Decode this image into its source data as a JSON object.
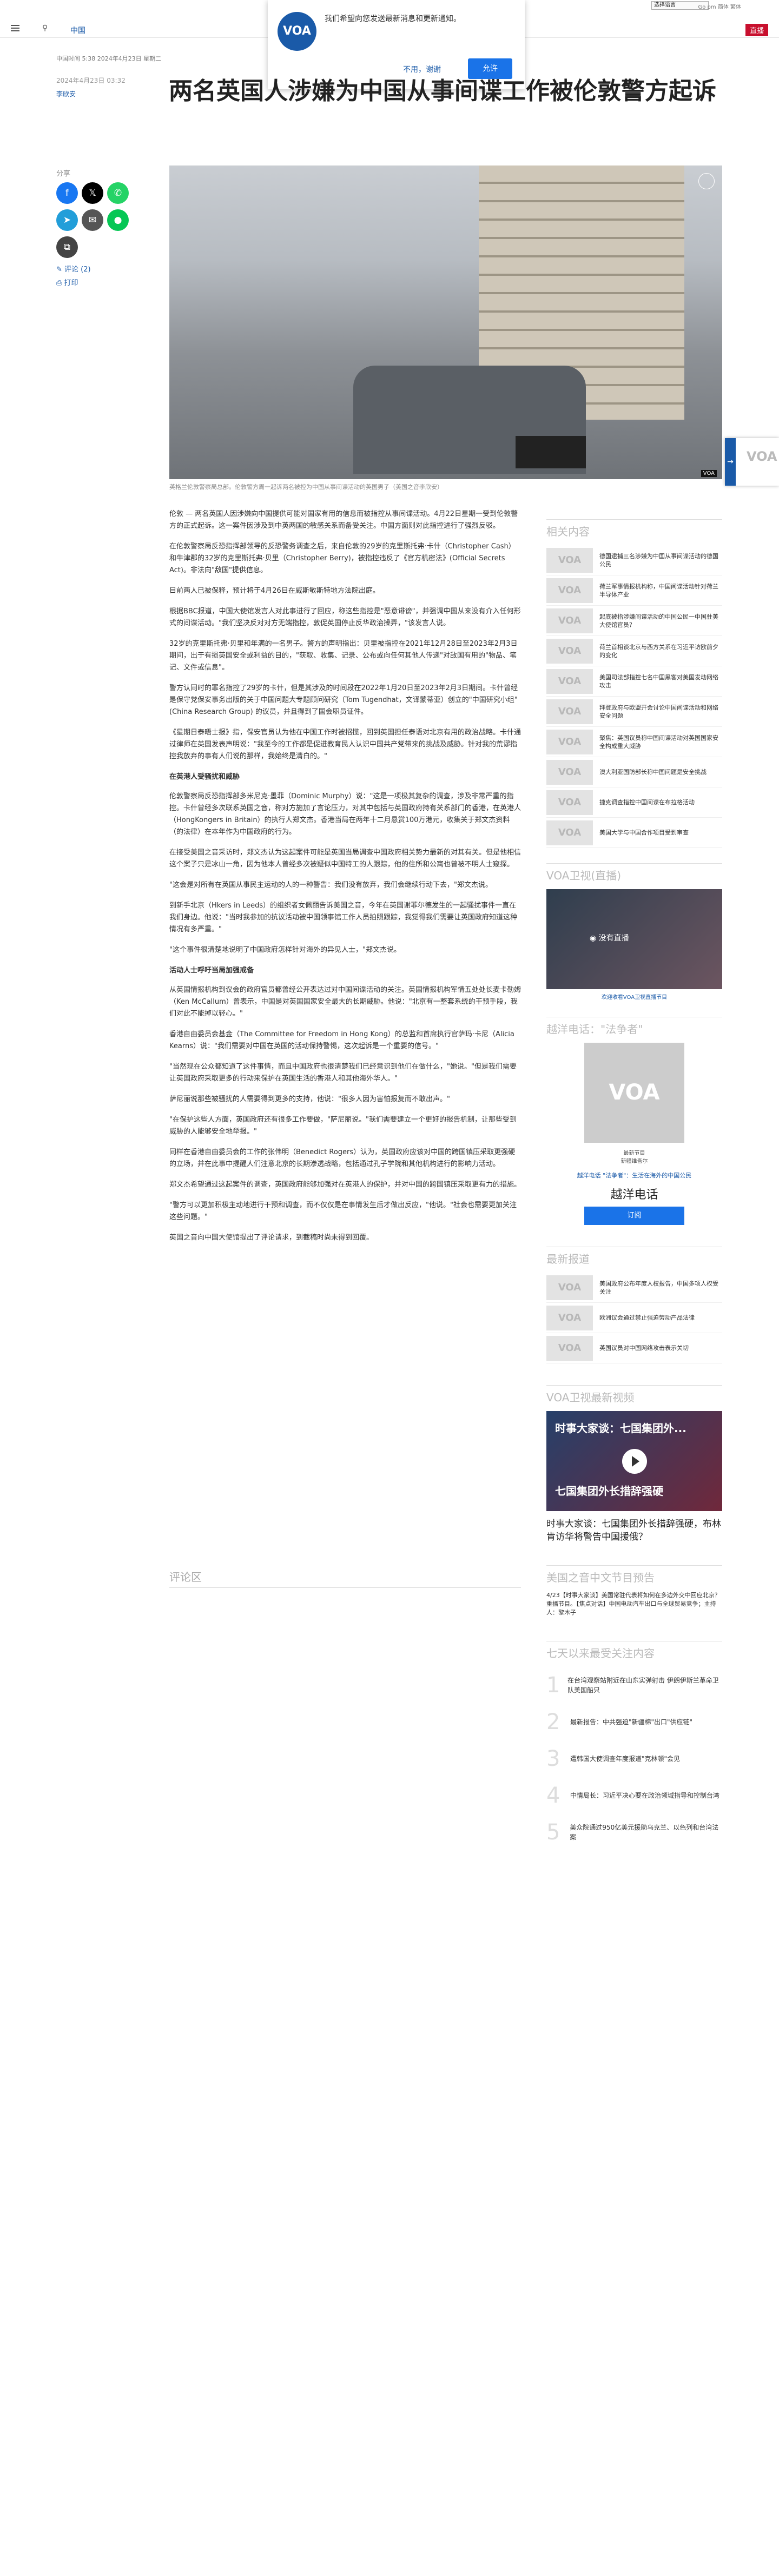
{
  "topbar": {
    "section": "中国",
    "lang_select": "选择语言",
    "lang_links": "Go pm 简体 繁体",
    "live": "直播"
  },
  "popup": {
    "logo": "VOA",
    "message": "我们希望向您发送最新消息和更新通知。",
    "decline": "不用，谢谢",
    "accept": "允许"
  },
  "article": {
    "meta": "中国时间 5:38 2024年4月23日 星期二",
    "pubdate": "2024年4月23日 03:32",
    "author": "李欣安",
    "title": "两名英国人涉嫌为中国从事间谍工作被伦敦警方起诉",
    "caption": "英格兰伦敦警察局总部。伦敦警方周一起诉两名被控为中国从事间谍活动的英国男子（美国之音李欣安）",
    "paragraphs": [
      "伦敦 — 两名英国人因涉嫌向中国提供可能对国家有用的信息而被指控从事间谍活动。4月22日星期一受到伦敦警方的正式起诉。这一案件因涉及到中英两国的敏感关系而备受关注。中国方面则对此指控进行了强烈反驳。",
      "在伦敦警察局反恐指挥部领导的反恐警务调查之后，来自伦敦的29岁的克里斯托弗·卡什（Christopher Cash）和牛津郡的32岁的克里斯托弗·贝里（Christopher Berry)，被指控违反了《官方机密法》(Official Secrets Act)。非法向\"敌国\"提供信息。",
      "目前两人已被保释，预计将于4月26日在威斯敏斯特地方法院出庭。",
      "根据BBC报道，中国大使馆发言人对此事进行了回应，称这些指控是\"恶意诽谤\"，并强调中国从来没有介入任何形式的间谍活动。\"我们坚决反对对方无端指控，敦促英国停止反华政治操弄，\"该发言人说。",
      "32岁的克里斯托弗·贝里和年满的一名男子。警方的声明指出：贝里被指控在2021年12月28日至2023年2月3日期间，出于有损英国安全或利益的目的，\"获取、收集、记录、公布或向任何其他人传递\"对敌国有用的\"物品、笔记、文件或信息\"。",
      "警方认同时的罪名指控了29岁的卡什，但是其涉及的时间段在2022年1月20日至2023年2月3日期间。卡什曾经是保守党保安事务出版的关于中国问题大专题顾问研究（Tom Tugendhat，文译蒙蒂亚）创立的\"中国研究小组\"(China Research Group) 的议员，并且得到了国会职员证件。",
      "《星期日泰晤士报》指，保安官员认为他在中国工作时被招揽，回到英国担任泰语对北京有用的政治战略。卡什通过律师在英国发表声明说：\"我至今的工作都是促进教育民人认识中国共产党带来的挑战及威胁。针对我的荒谬指控我放弃的事有人们说的那样，我始终是清白的。\""
    ],
    "h_uk": "在英港人受骚扰和威胁",
    "paragraphs2": [
      "伦敦警察局反恐指挥部多米尼克·墨菲（Dominic Murphy）说：\"这是一项极其复杂的调查，涉及非常严重的指控。卡什曾经多次联系英国之音，称对方施加了言论压力，对其中包括与英国政府持有关系部门的香港，在英港人（HongKongers in Britain）的执行人郑文杰。香港当局在两年十二月悬赏100万港元，收集关于郑文杰资料（的法律）在本年作为中国政府的行为。",
      "在接受美国之音采访时，郑文杰认为这起案件可能是英国当局调查中国政府相关势力最新的对其有关。但是他相信这个案子只是冰山一角，因为他本人曾经多次被疑似中国特工的人跟踪，他的住所和公寓也曾被不明人士窥探。",
      "\"这会是对所有在英国从事民主运动的人的一种警告：我们没有放弃，我们会继续行动下去，\"郑文杰说。",
      "到新手北京（Hkers in Leeds）的组织者女佩丽告诉美国之音，今年在英国谢菲尔德发生的一起骚扰事件一直在我们身边。他说：\"当时我参加的抗议活动被中国领事馆工作人员拍照跟踪，我觉得我们需要让英国政府知道这种情况有多严重。\"",
      "\"这个事件很清楚地说明了中国政府怎样针对海外的异见人士，\"郑文杰说。"
    ],
    "h_act": "活动人士呼吁当局加强戒备",
    "paragraphs3": [
      "从英国情报机构到议会的政府官员都曾经公开表达过对中国间谍活动的关注。英国情报机构军情五处处长麦卡勒姆（Ken McCallum）曾表示，中国是对英国国家安全最大的长期威胁。他说：\"北京有一整套系统的干预手段，我们对此不能掉以轻心。\"",
      "香港自由委员会基金（The Committee for Freedom in Hong Kong）的总监和首席执行官萨玛·卡尼（Alicia Kearns）说：\"我们需要对中国在英国的活动保持警惕，这次起诉是一个重要的信号。\"",
      "\"当然现在公众都知道了这件事情，而且中国政府也很清楚我们已经意识到他们在做什么，\"她说。\"但是我们需要让英国政府采取更多的行动来保护在英国生活的香港人和其他海外华人。\"",
      "萨尼丽说那些被骚扰的人需要得到更多的支持，他说：\"很多人因为害怕报复而不敢出声。\"",
      "\"在保护这些人方面，英国政府还有很多工作要做，\"萨尼丽说。\"我们需要建立一个更好的报告机制，让那些受到威胁的人能够安全地举报。\"",
      "同样在香港自由委员会的工作的张伟明（Benedict Rogers）认为，英国政府应该对中国的跨国镇压采取更强硬的立场，并在此事中提醒人们注意北京的长期渗透战略，包括通过孔子学院和其他机构进行的影响力活动。",
      "郑文杰希望通过这起案件的调查，英国政府能够加强对在英港人的保护，并对中国的跨国镇压采取更有力的措施。",
      "\"警方可以更加积极主动地进行干预和调查，而不仅仅是在事情发生后才做出反应，\"他说。\"社会也需要更加关注这些问题。\"",
      "英国之音向中国大使馆提出了评论请求，到截稿时尚未得到回覆。"
    ],
    "comments_label": "评论区"
  },
  "share": {
    "label": "分享",
    "comment_link": "评论 (2)",
    "print_link": "打印"
  },
  "rail": {
    "related_title": "相关内容",
    "related": [
      "德国逮捕三名涉嫌为中国从事间谍活动的德国公民",
      "荷兰军事情报机构称，中国间谍活动针对荷兰半导体产业",
      "起底被指涉嫌间谍活动的中国公民一中国驻美大使馆官员？",
      "荷兰首相谈北京与西方关系在习近平访欧前夕的变化",
      "美国司法部指控七名中国黑客对美国发动网络攻击",
      "拜登政府与欧盟开会讨论中国间谍活动和网络安全问题",
      "聚焦：英国议员称中国间谍活动对英国国家安全构成重大威胁",
      "澳大利亚国防部长称中国问题是安全挑战",
      "捷克调查指控中国间谍在布拉格活动",
      "美国大学与中国合作项目受到审查"
    ],
    "live_title": "VOA卫视(直播)",
    "live_now": "◉ 没有直播",
    "live_link": "欢迎收看VOA卫视直播节目",
    "phone_title": "越洋电话：\"法争者\"",
    "phone_logo": "VOA",
    "phone_s1": "最新节目",
    "phone_s2": "新疆维吾尔",
    "phone_link": "越洋电话 \"法争者\"：生活在海外的中国公民",
    "phone_name": "越洋电话",
    "phone_btn": "订阅",
    "latest_title": "最新报道",
    "latest": [
      "美国政府公布年度人权报告，中国多项人权受关注",
      "欧洲议会通过禁止强迫劳动产品法律",
      "英国议员对中国网络攻击表示关切"
    ],
    "video_title": "VOA卫视最新视频",
    "video_top": "时事大家谈：七国集团外...",
    "video_bottom": "七国集团外长措辞强硬",
    "video_caption": "时事大家谈：七国集团外长措辞强硬，布林肯访华将警告中国援俄？",
    "preview_title": "美国之音中文节目预告",
    "preview_text": "4/23【时事大家谈】美国常驻代表将如何在多边外交中回应北京？重播节目。【焦点对话】中国电动汽车出口与全球贸易竞争；主持人：黎木子",
    "rank_title": "七天以来最受关注内容",
    "ranks": [
      "在台湾观察站附近在山东实弹射击 伊朗伊斯兰革命卫队美国船只",
      "最新报告：中共强迫\"新疆棉\"出口\"供应链\"",
      "遭韩国大使调查年度报道\"克林顿\"会见",
      "中情局长：习近平决心要在政治领域指导和控制台湾",
      "美众院通过950亿美元援助乌克兰、以色列和台湾法案"
    ]
  },
  "side_tab": {
    "logo": "VOA"
  }
}
